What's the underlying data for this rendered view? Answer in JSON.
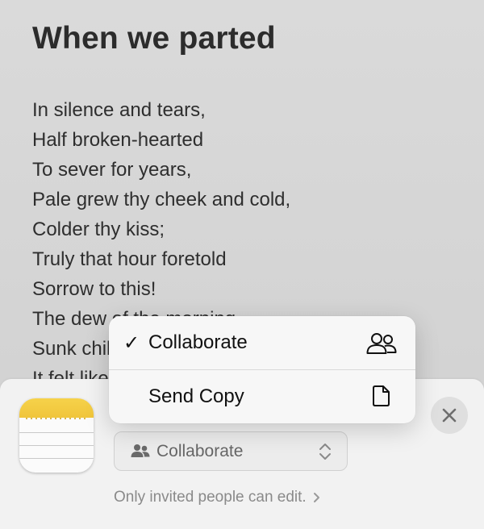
{
  "note": {
    "title": "When we parted",
    "lines": [
      "In silence and tears,",
      "Half broken-hearted",
      "To sever for years,",
      "Pale grew thy cheek and cold,",
      "Colder thy kiss;",
      "Truly that hour foretold",
      "Sorrow to this!",
      "The dew of the morning",
      "Sunk chill on my brow—",
      "It felt like the warning"
    ]
  },
  "menu": {
    "items": [
      {
        "label": "Collaborate",
        "checked": true,
        "icon": "people-icon"
      },
      {
        "label": "Send Copy",
        "checked": false,
        "icon": "document-icon"
      }
    ],
    "check_glyph": "✓"
  },
  "share_sheet": {
    "app_icon": "notes-app-icon",
    "mode_select": {
      "value": "Collaborate",
      "icon": "people-icon"
    },
    "hint": "Only invited people can edit.",
    "close_icon": "close-icon"
  }
}
